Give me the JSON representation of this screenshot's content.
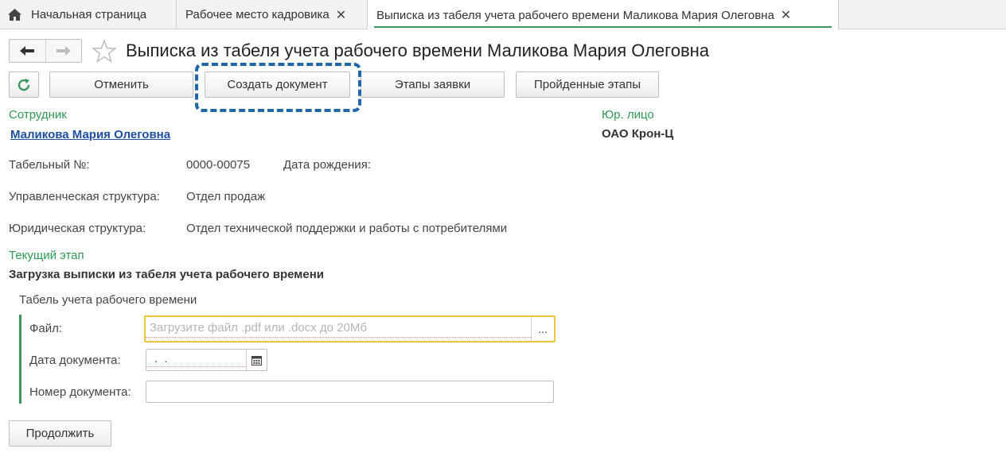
{
  "tabs": [
    {
      "label": "Начальная страница",
      "icon": "home-icon"
    },
    {
      "label": "Рабочее место кадровика",
      "close": "✕"
    },
    {
      "label": "Выписка из табеля учета рабочего времени Маликова Мария Олеговна",
      "close": "✕"
    }
  ],
  "header": {
    "title": "Выписка из табеля учета рабочего времени Маликова Мария Олеговна"
  },
  "toolbar": {
    "cancel_label": "Отменить",
    "create_document_label": "Создать документ",
    "request_stages_label": "Этапы заявки",
    "passed_stages_label": "Пройденные этапы"
  },
  "employee": {
    "caption": "Сотрудник",
    "name": "Маликова Мария Олеговна",
    "tab_number_label": "Табельный №:",
    "tab_number_value": "0000-00075",
    "birth_date_label": "Дата рождения:",
    "mgmt_structure_label": "Управленческая структура:",
    "mgmt_structure_value": "Отдел продаж",
    "legal_structure_label": "Юридическая структура:",
    "legal_structure_value": "Отдел технической поддержки и работы с потребителями"
  },
  "legal_entity": {
    "caption": "Юр. лицо",
    "value": "ОАО Крон-Ц"
  },
  "stage": {
    "caption": "Текущий этап",
    "value": "Загрузка выписки из табеля учета рабочего времени"
  },
  "timesheet": {
    "group_title": "Табель учета рабочего времени",
    "file_label": "Файл:",
    "file_placeholder": "Загрузите файл .pdf или .docx до 20Мб",
    "file_button": "...",
    "date_label": "Дата документа:",
    "date_value": ".  .",
    "number_label": "Номер документа:",
    "number_value": ""
  },
  "continue_label": "Продолжить",
  "colors": {
    "accent_green": "#2f9a55",
    "link_blue": "#1f4fa0",
    "highlight_blue": "#1f67a8",
    "focus_yellow": "#f0c43a"
  }
}
